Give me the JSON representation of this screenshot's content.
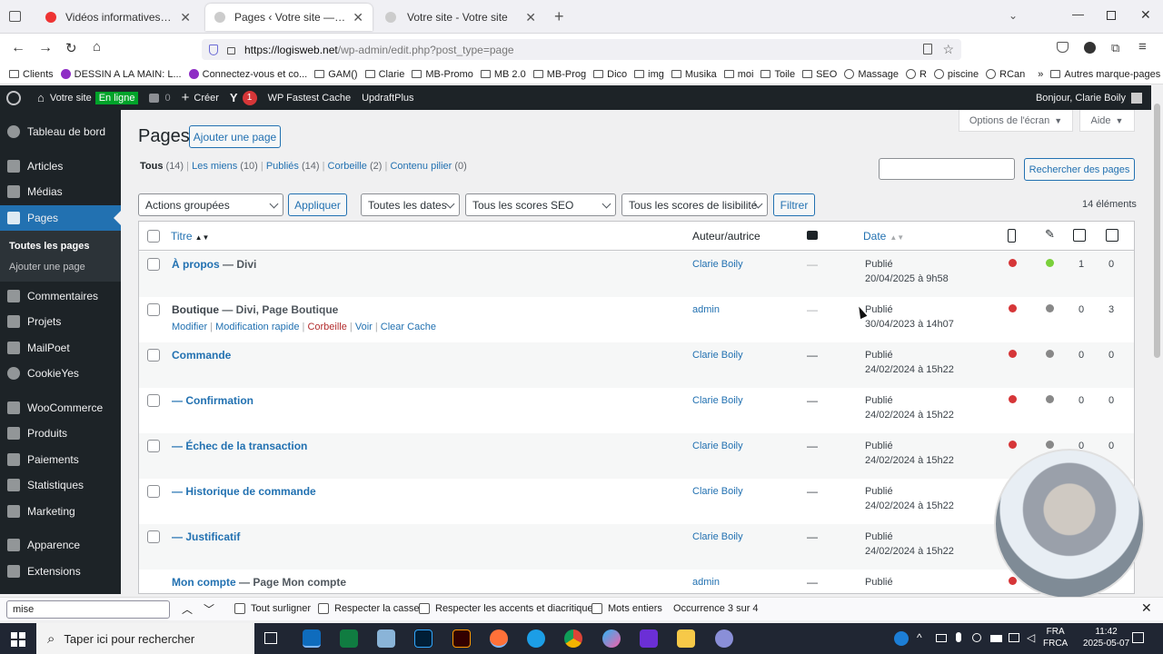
{
  "browser": {
    "tabs": [
      {
        "title": "Vidéos informatives pour votre"
      },
      {
        "title": "Pages ‹ Votre site — WordPress"
      },
      {
        "title": "Votre site - Votre site"
      }
    ],
    "url_host": "https://logisweb.net",
    "url_path": "/wp-admin/edit.php?post_type=page",
    "bookmarks": [
      "Clients",
      "DESSIN A LA MAIN: L...",
      "Connectez-vous et co...",
      "GAM()",
      "Clarie",
      "MB-Promo",
      "MB 2.0",
      "MB-Prog",
      "Dico",
      "img",
      "Musika",
      "moi",
      "Toile",
      "SEO",
      "Massage",
      "R",
      "piscine",
      "RCan"
    ],
    "more_bookmarks": "Autres marque-pages"
  },
  "adminbar": {
    "site": "Votre site",
    "online_badge": "En ligne",
    "comments_count": "0",
    "new_label": "Créer",
    "yoast_count": "1",
    "cache_label": "WP Fastest Cache",
    "updraft_label": "UpdraftPlus",
    "greeting": "Bonjour, Clarie Boily"
  },
  "sidebar": {
    "items": [
      {
        "label": "Tableau de bord"
      },
      {
        "label": "Articles"
      },
      {
        "label": "Médias"
      },
      {
        "label": "Pages"
      },
      {
        "label": "Commentaires"
      },
      {
        "label": "Projets"
      },
      {
        "label": "MailPoet"
      },
      {
        "label": "CookieYes"
      },
      {
        "label": "WooCommerce"
      },
      {
        "label": "Produits"
      },
      {
        "label": "Paiements"
      },
      {
        "label": "Statistiques"
      },
      {
        "label": "Marketing"
      },
      {
        "label": "Apparence"
      },
      {
        "label": "Extensions"
      }
    ],
    "sub_items": [
      "Toutes les pages",
      "Ajouter une page"
    ]
  },
  "page": {
    "title": "Pages",
    "add_button": "Ajouter une page",
    "screen_options": "Options de l'écran",
    "help": "Aide",
    "search_button": "Rechercher des pages",
    "filters": {
      "all": "Tous",
      "all_count": "(14)",
      "mine": "Les miens",
      "mine_count": "(10)",
      "published": "Publiés",
      "published_count": "(14)",
      "trash": "Corbeille",
      "trash_count": "(2)",
      "pillar": "Contenu pilier",
      "pillar_count": "(0)"
    },
    "bulk_select": "Actions groupées",
    "apply": "Appliquer",
    "dates_select": "Toutes les dates",
    "seo_select": "Tous les scores SEO",
    "readability_select": "Tous les scores de lisibilité",
    "filter_button": "Filtrer",
    "items_count": "14 éléments"
  },
  "table": {
    "headers": {
      "title": "Titre",
      "author": "Auteur/autrice",
      "date": "Date"
    },
    "row_actions": [
      "Modifier",
      "Modification rapide",
      "Corbeille",
      "Voir",
      "Clear Cache"
    ],
    "rows": [
      {
        "title": "À propos",
        "suffix": " — Divi",
        "author": "Clarie Boily",
        "comments": "—",
        "status": "Publié",
        "date": "20/04/2025 à 9h58",
        "seo": "#d63638",
        "read": "#7ad03a",
        "links": "1",
        "linked": "0"
      },
      {
        "title": "Boutique",
        "suffix": " — Divi, Page Boutique",
        "author": "admin",
        "comments": "—",
        "status": "Publié",
        "date": "30/04/2023 à 14h07",
        "seo": "#d63638",
        "read": "#888888",
        "links": "0",
        "linked": "3"
      },
      {
        "title": "Commande",
        "suffix": "",
        "author": "Clarie Boily",
        "comments": "—",
        "status": "Publié",
        "date": "24/02/2024 à 15h22",
        "seo": "#d63638",
        "read": "#888888",
        "links": "0",
        "linked": "0"
      },
      {
        "title": "— Confirmation",
        "suffix": "",
        "author": "Clarie Boily",
        "comments": "—",
        "status": "Publié",
        "date": "24/02/2024 à 15h22",
        "seo": "#d63638",
        "read": "#888888",
        "links": "0",
        "linked": "0"
      },
      {
        "title": "— Échec de la transaction",
        "suffix": "",
        "author": "Clarie Boily",
        "comments": "—",
        "status": "Publié",
        "date": "24/02/2024 à 15h22",
        "seo": "#d63638",
        "read": "#888888",
        "links": "0",
        "linked": "0"
      },
      {
        "title": "— Historique de commande",
        "suffix": "",
        "author": "Clarie Boily",
        "comments": "—",
        "status": "Publié",
        "date": "24/02/2024 à 15h22",
        "seo": "",
        "read": "",
        "links": "",
        "linked": ""
      },
      {
        "title": "— Justificatif",
        "suffix": "",
        "author": "Clarie Boily",
        "comments": "—",
        "status": "Publié",
        "date": "24/02/2024 à 15h22",
        "seo": "",
        "read": "",
        "links": "",
        "linked": ""
      },
      {
        "title": "Mon compte",
        "suffix": " — Page Mon compte",
        "author": "admin",
        "comments": "—",
        "status": "Publié",
        "date": "",
        "seo": "#d63638",
        "read": "",
        "links": "",
        "linked": ""
      }
    ]
  },
  "findbar": {
    "query": "mise",
    "highlight_all": "Tout surligner",
    "match_case": "Respecter la casse",
    "match_diacritics": "Respecter les accents et diacritiques",
    "whole_words": "Mots entiers",
    "status": "Occurrence 3 sur 4"
  },
  "taskbar": {
    "search_placeholder": "Taper ici pour rechercher",
    "lang1": "FRA",
    "lang2": "FRCA",
    "time": "11:42",
    "date": "2025-05-07"
  }
}
